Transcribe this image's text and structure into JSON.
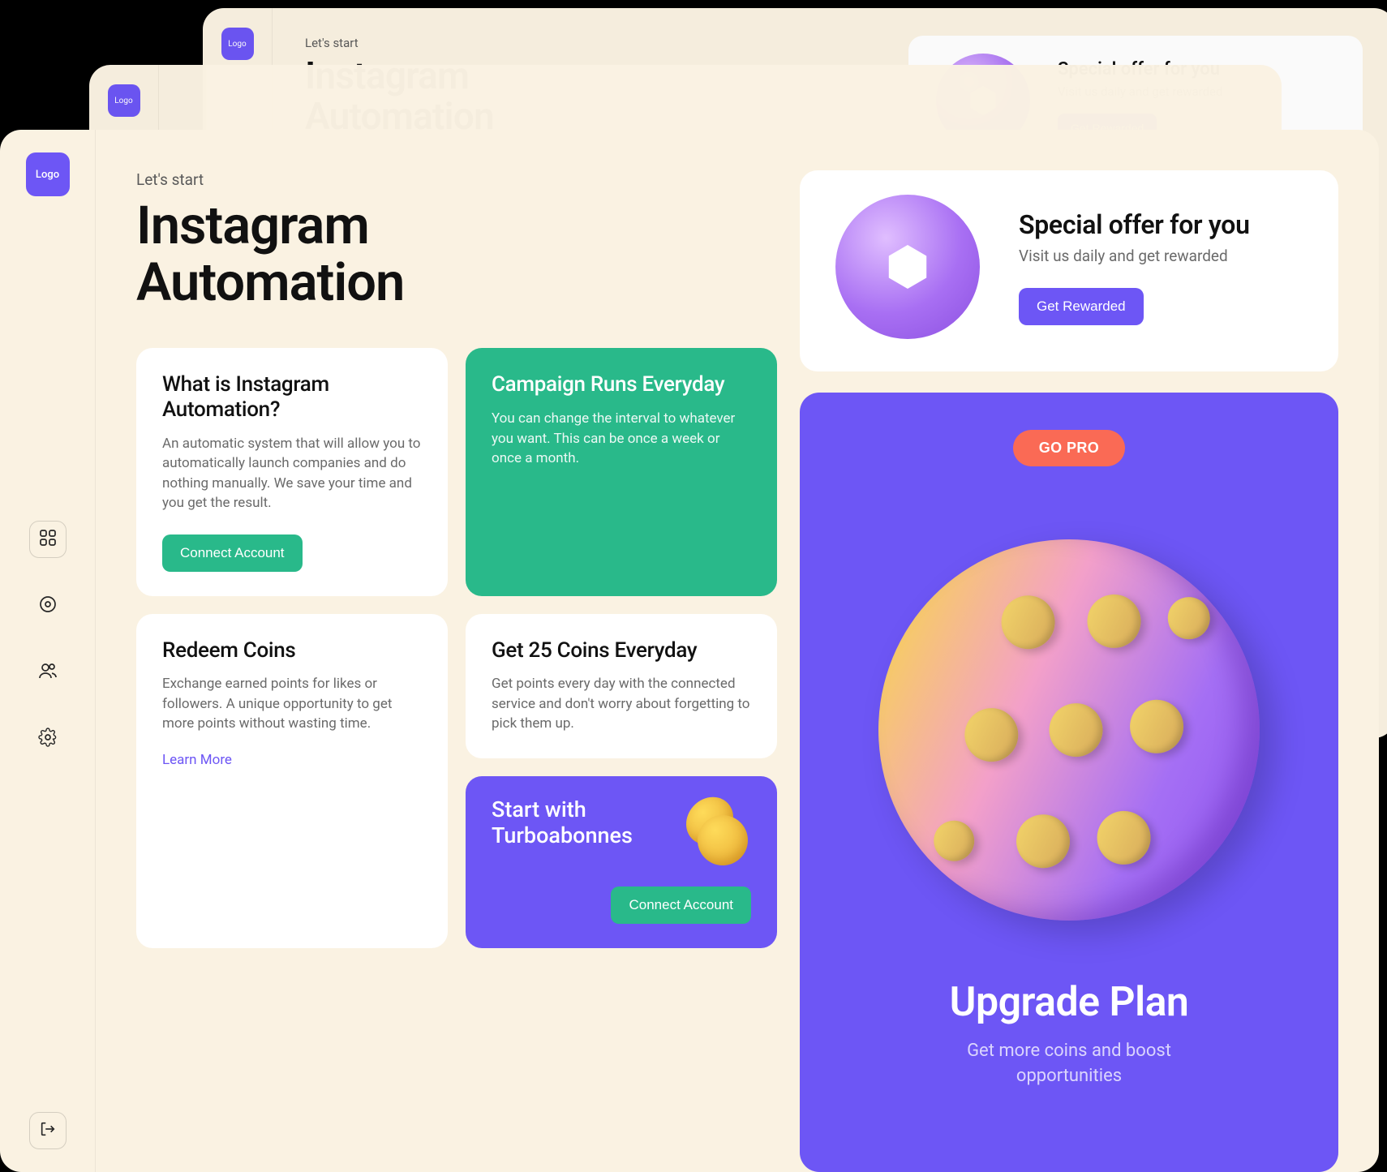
{
  "logo_text": "Logo",
  "header": {
    "prelabel": "Let's start",
    "title": "Instagram\nAutomation"
  },
  "offer": {
    "title": "Special offer for you",
    "subtitle": "Visit us daily and get rewarded",
    "button": "Get Rewarded"
  },
  "cards": {
    "what_is": {
      "title": "What is Instagram Automation?",
      "desc": "An automatic system that will allow you to automatically launch companies and do nothing manually. We save your time and you get the result.",
      "button": "Connect Account"
    },
    "campaign": {
      "title": "Campaign Runs Everyday",
      "desc": "You can change the interval to whatever you want. This can be once a week or once a month."
    },
    "redeem": {
      "title": "Redeem Coins",
      "desc": "Exchange earned points for likes or followers. A unique opportunity to get more points without wasting time.",
      "link": "Learn More"
    },
    "coins25": {
      "title": "Get 25 Coins Everyday",
      "desc": "Get points every day with the connected service and don't worry about forgetting to pick them up."
    },
    "turbo": {
      "title": "Start with Turboabonnes",
      "button": "Connect Account"
    }
  },
  "upgrade": {
    "badge": "GO PRO",
    "title": "Upgrade Plan",
    "subtitle": "Get more coins and boost opportunities"
  }
}
